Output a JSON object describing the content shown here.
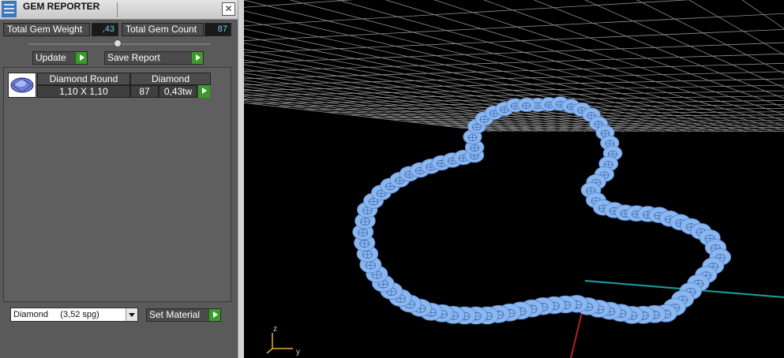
{
  "window": {
    "title": "GEM REPORTER",
    "close_glyph": "✕"
  },
  "summary": {
    "total_weight_label": "Total Gem Weight",
    "total_weight_value": ",43",
    "total_count_label": "Total Gem Count",
    "total_count_value": "87"
  },
  "toolbar": {
    "update_label": "Update",
    "save_report_label": "Save Report"
  },
  "gem_table": {
    "header_name": "Diamond Round",
    "header_material": "Diamond",
    "size": "1,10 X 1,10",
    "count": "87",
    "weight": "0,43tw"
  },
  "material": {
    "selected": "Diamond     (3,52 spg)",
    "set_label": "Set Material"
  },
  "colors": {
    "gem": "#8ab7f0",
    "grid": "#8f8f8f",
    "axis_x": "#b8211a",
    "axis_y": "#19a3a3"
  },
  "viewport_axes": {
    "z": "z",
    "y": "y"
  }
}
